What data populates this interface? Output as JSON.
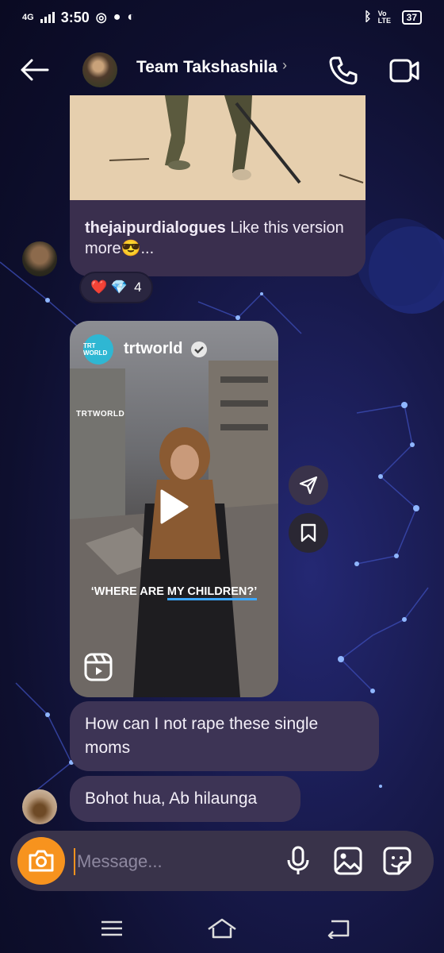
{
  "status_bar": {
    "network": "4G",
    "time": "3:50",
    "battery": "37",
    "volte": "Vo LTE"
  },
  "header": {
    "title": "Team Takshashila",
    "chevron": "›"
  },
  "post": {
    "username": "thejaipurdialogues",
    "text": " Like this version more😎..."
  },
  "reactions": {
    "emojis": "❤️ 💎",
    "count": "4"
  },
  "reel": {
    "logo_text": "TRT WORLD",
    "username": "trtworld",
    "watermark": "TRTWORLD",
    "caption_prefix": "‘WHERE ARE ",
    "caption_highlight": "MY CHILDREN?’"
  },
  "messages": [
    {
      "text": "How can I not rape these single moms"
    },
    {
      "text": "Bohot hua, Ab hilaunga"
    }
  ],
  "composer": {
    "placeholder": "Message..."
  },
  "colors": {
    "accent": "#f7931e",
    "bubble": "#3d3455",
    "background": "#14163f"
  }
}
